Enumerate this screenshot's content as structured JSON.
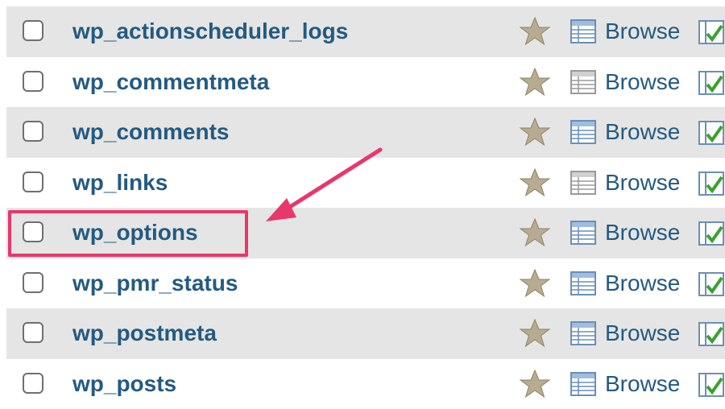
{
  "tables": [
    {
      "name": "wp_actionscheduler_logs",
      "browse_label": "Browse",
      "browse_icon": "table-browse-icon-blue"
    },
    {
      "name": "wp_commentmeta",
      "browse_label": "Browse",
      "browse_icon": "table-browse-icon-gray"
    },
    {
      "name": "wp_comments",
      "browse_label": "Browse",
      "browse_icon": "table-browse-icon-blue"
    },
    {
      "name": "wp_links",
      "browse_label": "Browse",
      "browse_icon": "table-browse-icon-gray"
    },
    {
      "name": "wp_options",
      "browse_label": "Browse",
      "browse_icon": "table-browse-icon-blue"
    },
    {
      "name": "wp_pmr_status",
      "browse_label": "Browse",
      "browse_icon": "table-browse-icon-blue"
    },
    {
      "name": "wp_postmeta",
      "browse_label": "Browse",
      "browse_icon": "table-browse-icon-blue"
    },
    {
      "name": "wp_posts",
      "browse_label": "Browse",
      "browse_icon": "table-browse-icon-blue"
    }
  ],
  "annotation": {
    "highlighted_table": "wp_options",
    "highlight_color": "#e8376b"
  },
  "colors": {
    "link": "#235a81",
    "row_alt": "#e5e5e5",
    "star": "#b7ab91"
  }
}
